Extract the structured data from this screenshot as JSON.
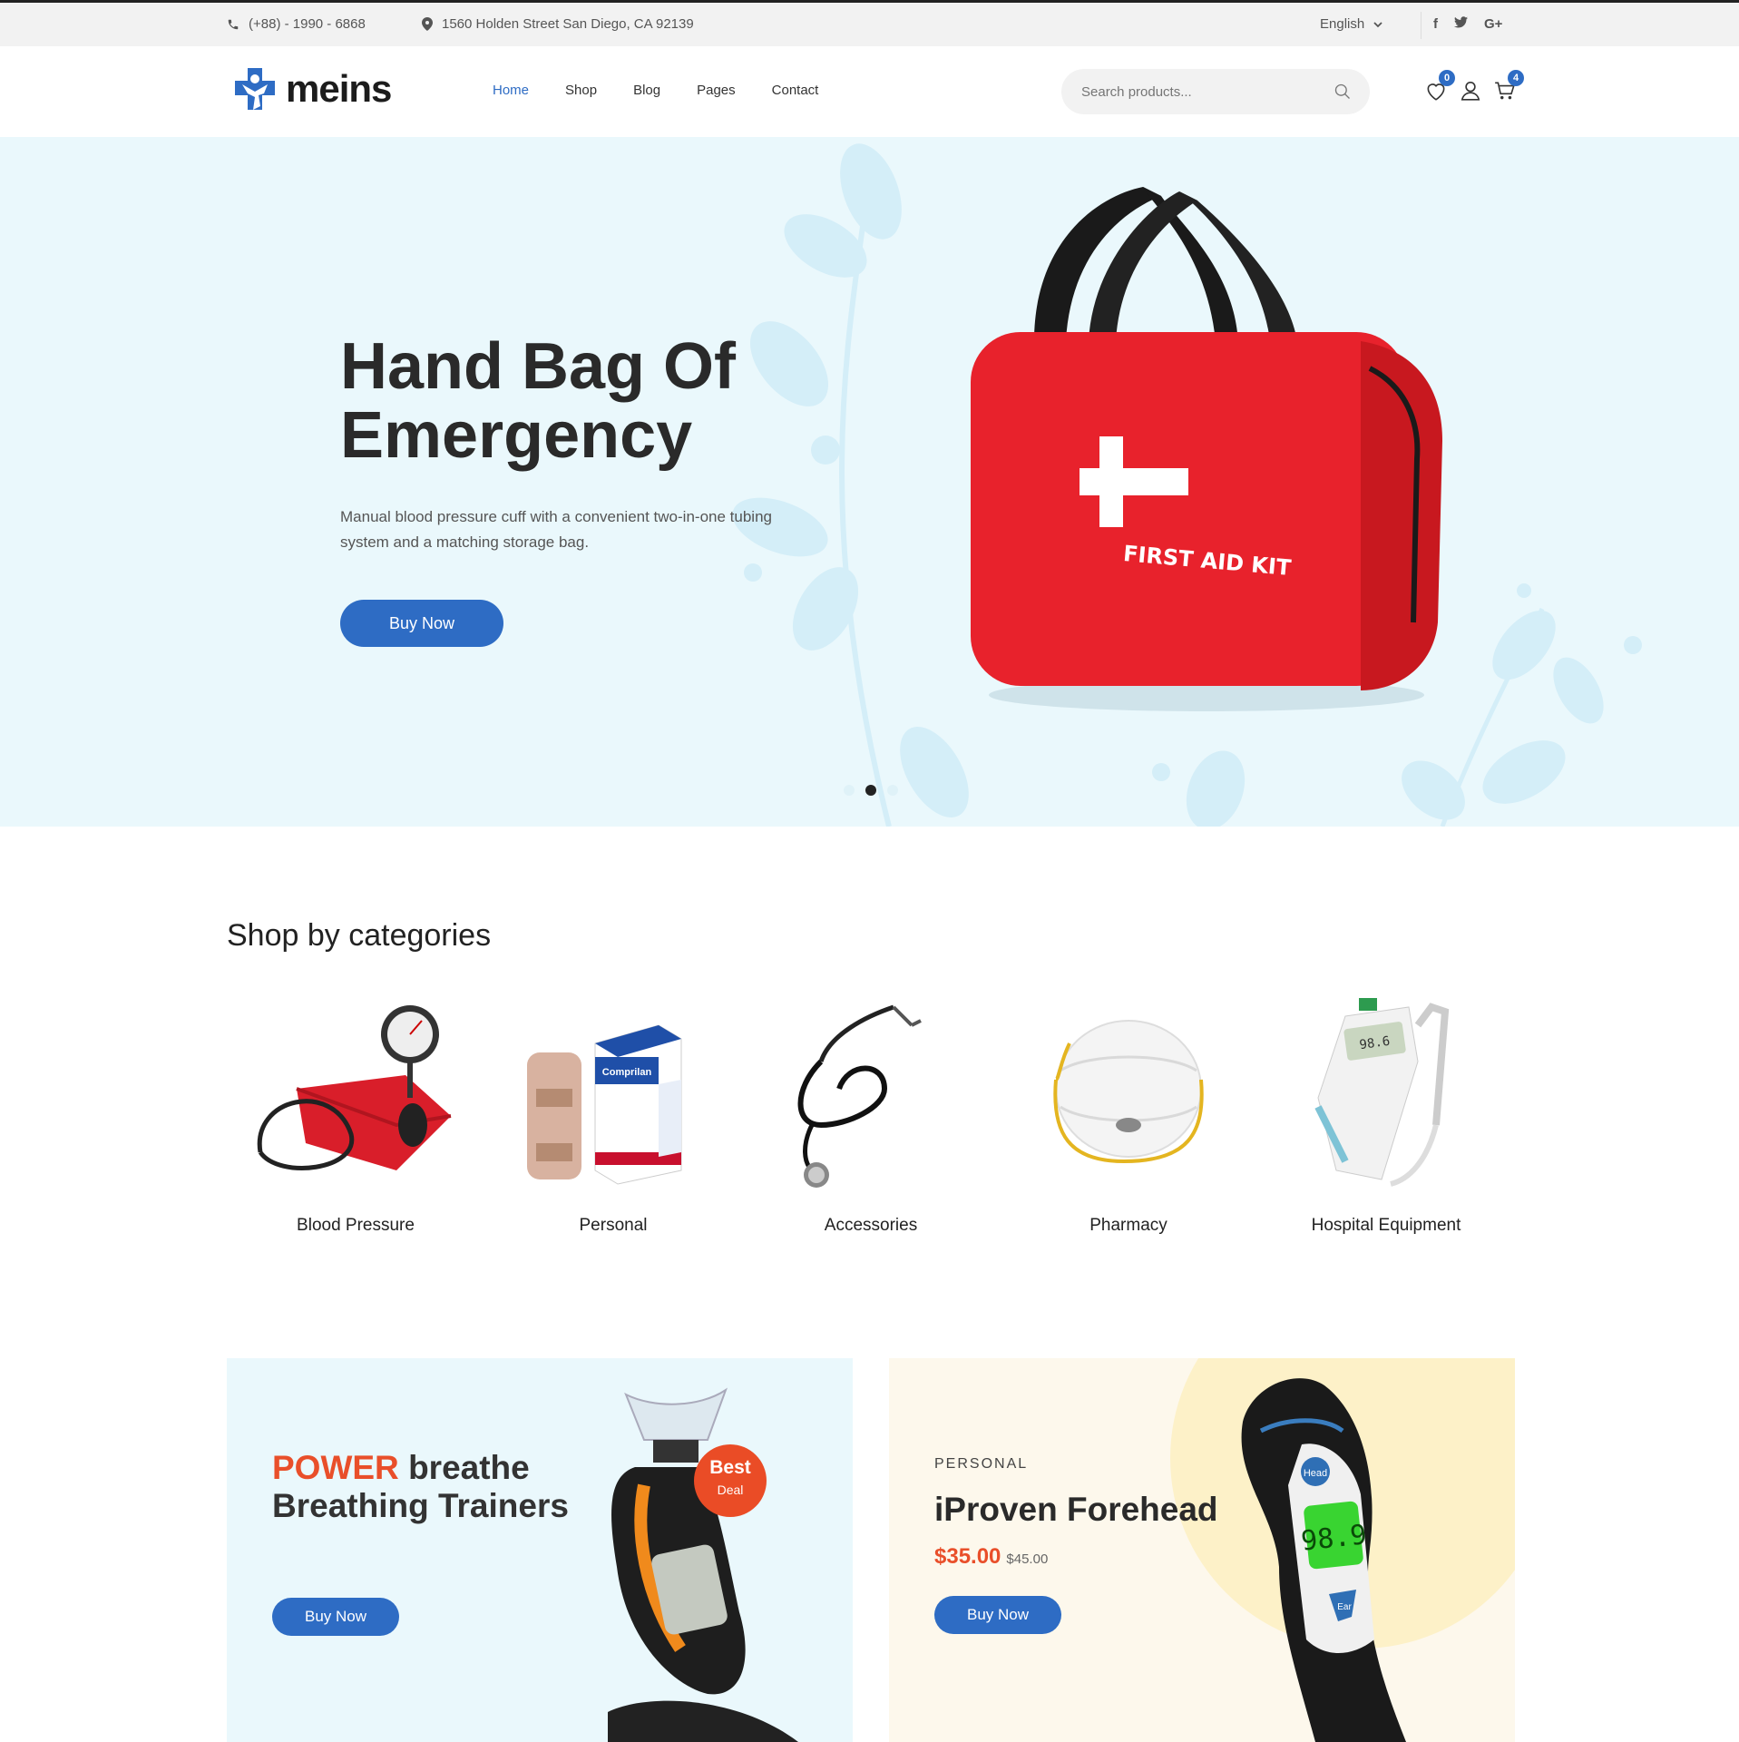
{
  "topbar": {
    "phone": "(+88) - 1990 - 6868",
    "address": "1560 Holden Street San Diego, CA 92139",
    "language": "English",
    "social": [
      "f",
      "t",
      "G+"
    ]
  },
  "header": {
    "logo": "meins",
    "nav": [
      "Home",
      "Shop",
      "Blog",
      "Pages",
      "Contact"
    ],
    "search_placeholder": "Search products...",
    "wishlist_count": "0",
    "cart_count": "4"
  },
  "hero": {
    "title": "Hand Bag Of Emergency",
    "description": "Manual blood pressure cuff with a convenient two-in-one tubing system and a matching storage bag.",
    "button": "Buy Now",
    "bag_text": "FIRST AID KIT",
    "slides": 3,
    "active_slide": 2
  },
  "categories": {
    "title": "Shop by categories",
    "items": [
      "Blood Pressure",
      "Personal",
      "Accessories",
      "Pharmacy",
      "Hospital Equipment"
    ]
  },
  "banners": {
    "left": {
      "title_highlight": "POWER",
      "title_rest": "breathe Breathing Trainers",
      "badge_1": "Best",
      "badge_2": "Deal",
      "button": "Buy Now"
    },
    "right": {
      "subtitle": "PERSONAL",
      "title": "iProven Forehead",
      "price": "$35.00",
      "old_price": "$45.00",
      "button": "Buy Now"
    }
  },
  "colors": {
    "accent": "#2e6cc4",
    "highlight": "#e94f2a",
    "hero_bg": "#eaf8fc",
    "banner_warm_bg": "#fdf8ec"
  }
}
